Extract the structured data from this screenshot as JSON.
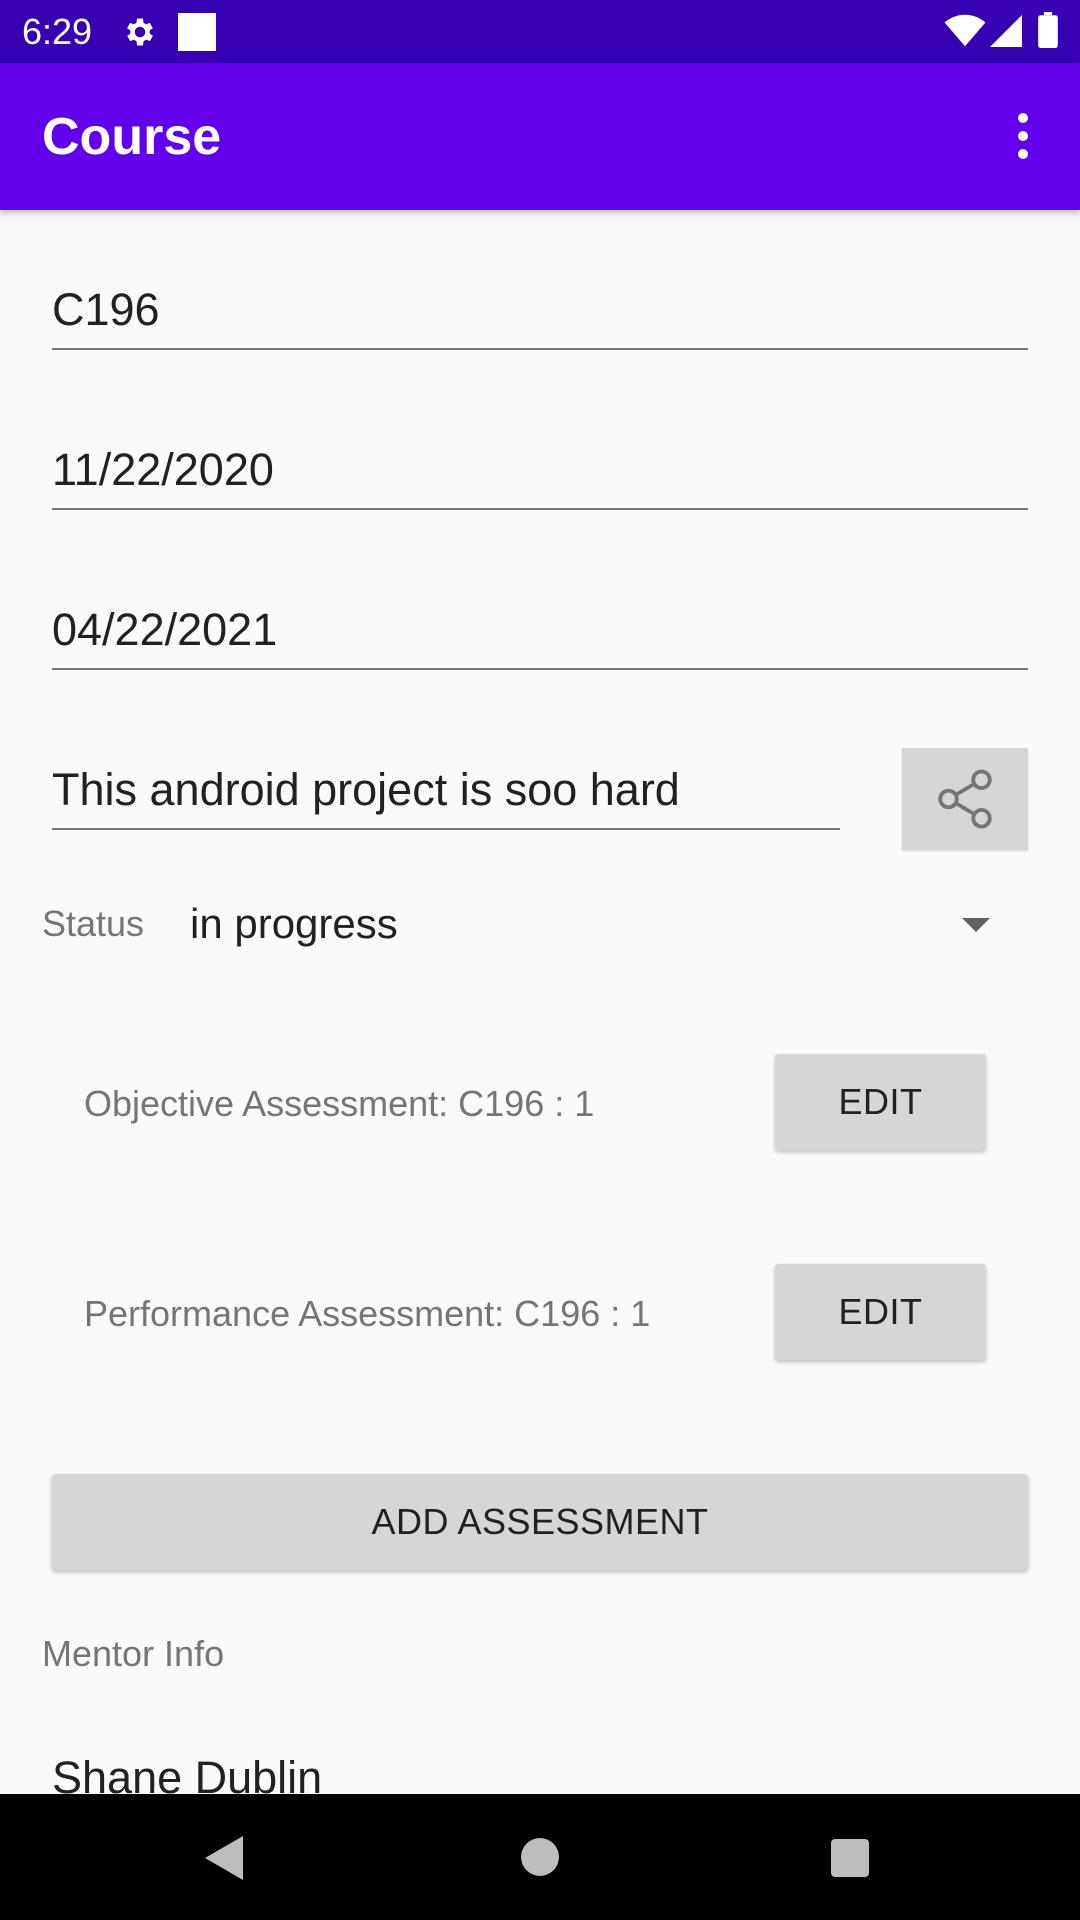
{
  "status_bar": {
    "time": "6:29",
    "icons": [
      "gear-icon",
      "notification-square-icon",
      "wifi-icon",
      "signal-icon",
      "battery-icon"
    ]
  },
  "app_bar": {
    "title": "Course",
    "menu_icon": "overflow-menu-icon",
    "background": "#6200ee"
  },
  "form": {
    "course_name": "C196",
    "start_date": "11/22/2020",
    "end_date": "04/22/2021",
    "note": "This android project is soo hard",
    "share_icon": "share-icon",
    "status_label": "Status",
    "status_value": "in progress"
  },
  "assessments": [
    {
      "label": "Objective Assessment: C196 : 1",
      "button": "EDIT"
    },
    {
      "label": "Performance Assessment: C196 : 1",
      "button": "EDIT"
    }
  ],
  "add_assessment_label": "ADD ASSESSMENT",
  "mentor": {
    "section_label": "Mentor Info",
    "name": "Shane Dublin"
  },
  "colors": {
    "status_bar": "#3700b3",
    "accent": "#6200ee",
    "button_bg": "#d6d6d6"
  }
}
